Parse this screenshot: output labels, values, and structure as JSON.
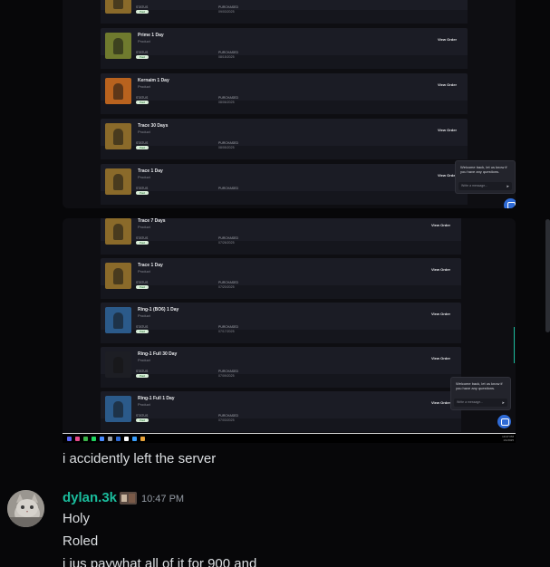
{
  "screenshot_top": {
    "orders": [
      {
        "name": "Trace 30 Days",
        "type": "Product",
        "status_label": "STATUS",
        "status": "Paid",
        "purchased_label": "PURCHASED",
        "date": "09/03/2025",
        "action": "View Order",
        "thumb_color": "#8a6a2a"
      },
      {
        "name": "Prime 1 Day",
        "type": "Product",
        "status_label": "STATUS",
        "status": "Paid",
        "purchased_label": "PURCHASED",
        "date": "08/15/2025",
        "action": "View Order",
        "thumb_color": "#6f7a2e"
      },
      {
        "name": "Kernaim 1 Day",
        "type": "Product",
        "status_label": "STATUS",
        "status": "Paid",
        "purchased_label": "PURCHASED",
        "date": "08/06/2025",
        "action": "View Order",
        "thumb_color": "#b8621e"
      },
      {
        "name": "Trace 30 Days",
        "type": "Product",
        "status_label": "STATUS",
        "status": "Paid",
        "purchased_label": "PURCHASED",
        "date": "08/05/2025",
        "action": "View Order",
        "thumb_color": "#8a6a2a"
      },
      {
        "name": "Trace 1 Day",
        "type": "Product",
        "status_label": "STATUS",
        "status": "Paid",
        "purchased_label": "PURCHASED",
        "date": "",
        "action": "View Order",
        "thumb_color": "#8a6a2a"
      }
    ],
    "chat_popup": {
      "message": "Welcome back, let us know if you have any questions.",
      "placeholder": "Write a message..."
    }
  },
  "screenshot_bottom": {
    "orders": [
      {
        "name": "Trace 7 Days",
        "type": "Product",
        "status_label": "STATUS",
        "status": "Paid",
        "purchased_label": "PURCHASED",
        "date": "07/26/2025",
        "action": "View Order",
        "thumb_color": "#8a6a2a"
      },
      {
        "name": "Trace 1 Day",
        "type": "Product",
        "status_label": "STATUS",
        "status": "Paid",
        "purchased_label": "PURCHASED",
        "date": "07/20/2025",
        "action": "View Order",
        "thumb_color": "#8a6a2a"
      },
      {
        "name": "Ring-1 (BO6) 1 Day",
        "type": "Product",
        "status_label": "STATUS",
        "status": "Paid",
        "purchased_label": "PURCHASED",
        "date": "07/17/2025",
        "action": "View Order",
        "thumb_color": "#2b5a8a"
      },
      {
        "name": "Ring-1 Full 30 Day",
        "type": "Product",
        "status_label": "STATUS",
        "status": "Paid",
        "purchased_label": "PURCHASED",
        "date": "07/09/2025",
        "action": "View Order",
        "thumb_color": "#1d1e24"
      },
      {
        "name": "Ring-1 Full 1 Day",
        "type": "Product",
        "status_label": "STATUS",
        "status": "Paid",
        "purchased_label": "PURCHASED",
        "date": "07/03/2025",
        "action": "View Order",
        "thumb_color": "#2b5a8a"
      }
    ],
    "chat_popup": {
      "message": "Welcome back, let us know if you have any questions.",
      "placeholder": "Write a message..."
    },
    "taskbar": {
      "icons": [
        "#5865f2",
        "#e84a8a",
        "#3bb54a",
        "#1ed760",
        "#4a8cff",
        "#9aa0a6",
        "#2f6bd6",
        "#ffffff",
        "#3aa0ff",
        "#e8a33a"
      ],
      "time": "10:47 PM",
      "date": "1/1/2025"
    }
  },
  "messages": {
    "previous_text": "i accidently left the server",
    "author": "dylan.3k",
    "timestamp": "10:47 PM",
    "lines": [
      "Holy",
      "Roled",
      "i jus paywhat all of it for 900 and"
    ],
    "accent": "#1abc9c"
  }
}
